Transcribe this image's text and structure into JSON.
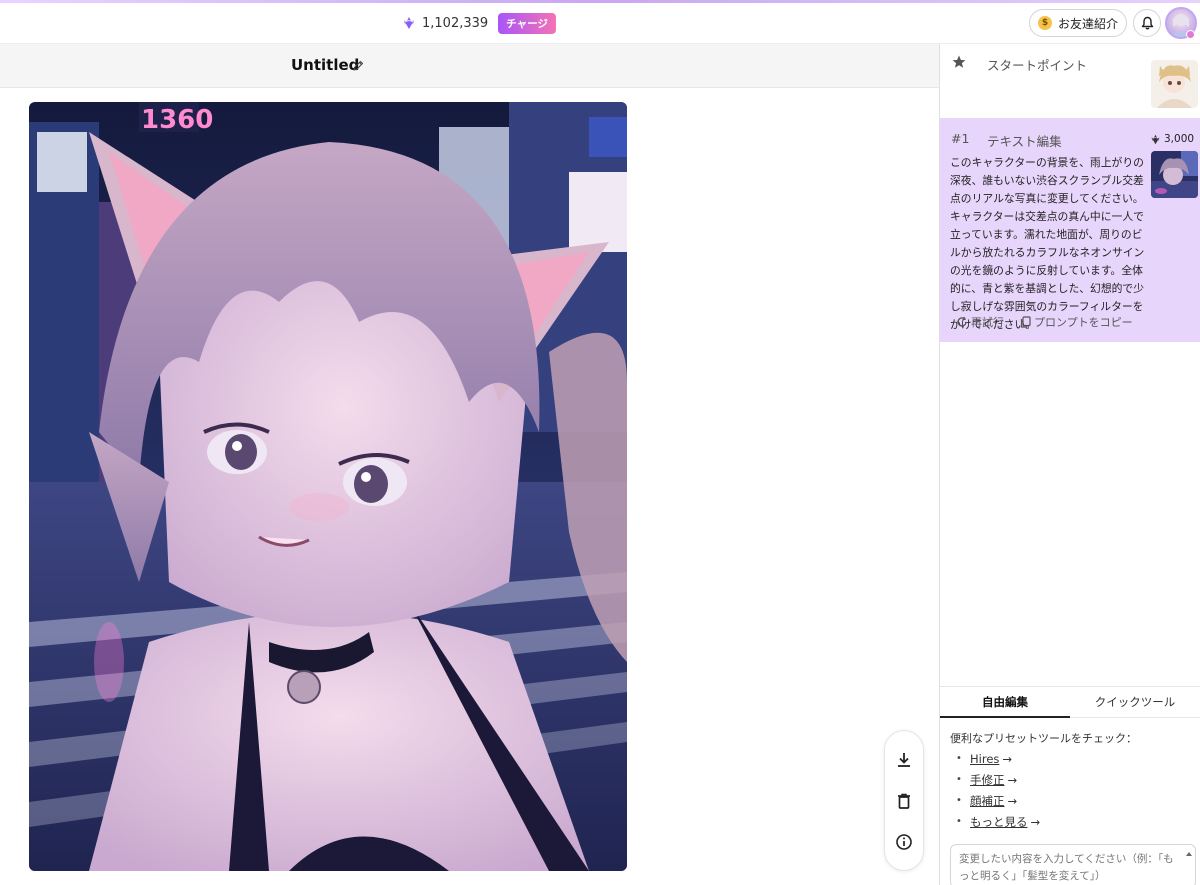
{
  "header": {
    "credits": "1,102,339",
    "charge_label": "チャージ",
    "referral_label": "お友達紹介"
  },
  "editor": {
    "title": "Untitled"
  },
  "history": {
    "start_label": "スタートポイント",
    "steps": [
      {
        "number": "#1",
        "label": "テキスト編集",
        "cost": "3,000",
        "prompt": "このキャラクターの背景を、雨上がりの深夜、誰もいない渋谷スクランブル交差点のリアルな写真に変更してください。キャラクターは交差点の真ん中に一人で立っています。濡れた地面が、周りのビルから放たれるカラフルなネオンサインの光を鏡のように反射しています。全体的に、青と紫を基調とした、幻想的で少し寂しげな雰囲気のカラーフィルターをかけてください。",
        "retry_label": "再試行",
        "copy_label": "プロンプトをコピー"
      }
    ]
  },
  "tabs": [
    {
      "label": "自由編集",
      "active": true
    },
    {
      "label": "クイックツール",
      "active": false
    }
  ],
  "presets": {
    "title": "便利なプリセットツールをチェック：",
    "items": [
      {
        "label": "Hires",
        "arrow": "→"
      },
      {
        "label": "手修正",
        "arrow": "→"
      },
      {
        "label": "顔補正",
        "arrow": "→"
      },
      {
        "label": "もっと見る",
        "arrow": "→"
      }
    ]
  },
  "edit_input": {
    "placeholder": "変更したい内容を入力してください（例：「もっと明るく」「髪型を変えて」）"
  },
  "colors": {
    "accent_purple": "#a855f7",
    "accent_pink": "#f472b6",
    "selected_card": "#e8d5fb"
  }
}
